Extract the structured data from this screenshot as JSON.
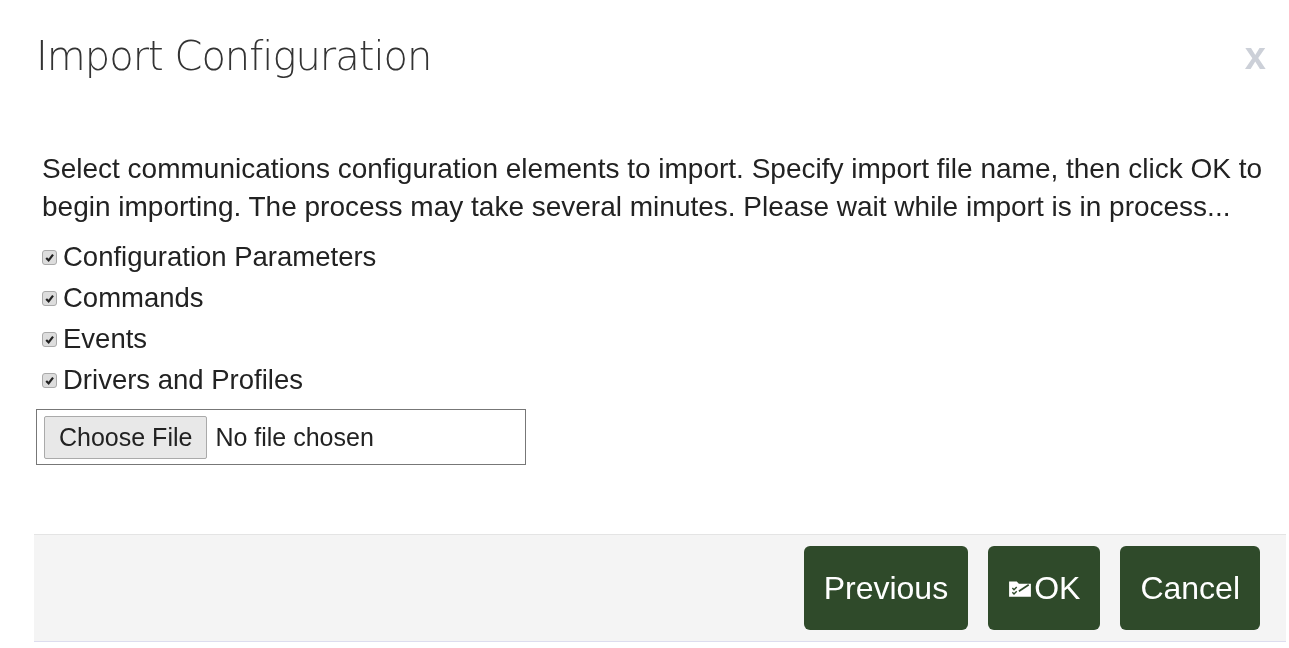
{
  "dialog": {
    "title": "Import Configuration",
    "close": "x"
  },
  "instructions": "Select communications configuration elements to import. Specify import file name, then click OK to begin importing. The process may take several minutes. Please wait while import is in process...",
  "options": [
    {
      "label": "Configuration Parameters",
      "checked": true
    },
    {
      "label": "Commands",
      "checked": true
    },
    {
      "label": "Events",
      "checked": true
    },
    {
      "label": "Drivers and Profiles",
      "checked": true
    }
  ],
  "file_input": {
    "button": "Choose File",
    "status": "No file chosen"
  },
  "buttons": [
    {
      "label": "Previous",
      "kind": "plain"
    },
    {
      "label": "OK",
      "kind": "icon"
    },
    {
      "label": "Cancel",
      "kind": "plain"
    }
  ]
}
